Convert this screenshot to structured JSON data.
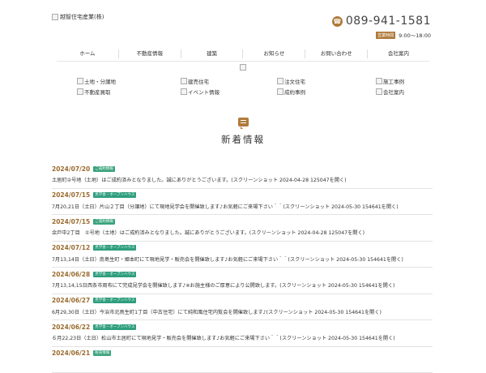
{
  "header": {
    "logo_alt": "越智住宅産業(株)",
    "phone": "089-941-1581",
    "hours_label": "営業時間",
    "hours": "9:00～18:00"
  },
  "nav": [
    "ホーム",
    "不動産情報",
    "建築",
    "お知らせ",
    "お問い合わせ",
    "会社案内"
  ],
  "quick_links": [
    [
      "土地・分譲地",
      "建売住宅",
      "注文住宅",
      "施工事例"
    ],
    [
      "不動産買取",
      "イベント情報",
      "成約事例",
      "会社案内"
    ]
  ],
  "section_title": "新着情報",
  "colors": {
    "accent": "#b07a3a",
    "date": "#9a6b2e",
    "badge_sold": "#3aa37c",
    "badge_event": "#2e9e7d"
  },
  "news": [
    {
      "date": "2024/07/20",
      "badge": "ご成約情報",
      "text": "土居町②号地（土地）はご成約済みとなりました。誠にありがとうございます。(スクリーンショット 2024-04-28 125047を開く)"
    },
    {
      "date": "2024/07/15",
      "badge": "見学会・オープンハウス",
      "text": "7月20,21日（土日）片山２丁目（分譲地）にて現地見学会を開催致します♪お気軽にご来場下さい＾＾(スクリーンショット 2024-05-30 154641を開く)"
    },
    {
      "date": "2024/07/15",
      "badge": "ご成約情報",
      "text": "余戸中2丁目　①号地（土地）はご成約済みとなりました。誠にありがとうございます。(スクリーンショット 2024-04-28 125047を開く)"
    },
    {
      "date": "2024/07/12",
      "badge": "見学会・オープンハウス",
      "text": "7月13,14日（土日）南島生町・郷本町にて現地見学・販売会を開催致します♪お気軽にご来場下さい＾＾(スクリーンショット 2024-05-30 154641を開く)"
    },
    {
      "date": "2024/06/28",
      "badge": "見学会・オープンハウス",
      "text": "7月13,14,15日西条市周布にて完成見学会を開催致します♪※お施主様のご厚意により公開致します。(スクリーンショット 2024-05-30 154641を開く)"
    },
    {
      "date": "2024/06/27",
      "badge": "見学会・オープンハウス",
      "text": "6月29,30日（土日）今治市北鳥生町1丁目（中古住宅）にて純和風住宅内覧会を開催致します♪(スクリーンショット 2024-05-30 154641を開く)"
    },
    {
      "date": "2024/06/22",
      "badge": "見学会・オープンハウス",
      "text": "６月22,23日（土日）松山市土居町にて現地見学・販売会を開催致します♪お気軽にご来場下さい＾＾(スクリーンショット 2024-05-30 154641を開く)"
    },
    {
      "date": "2024/06/21",
      "badge": "販売情報",
      "text": ""
    }
  ]
}
